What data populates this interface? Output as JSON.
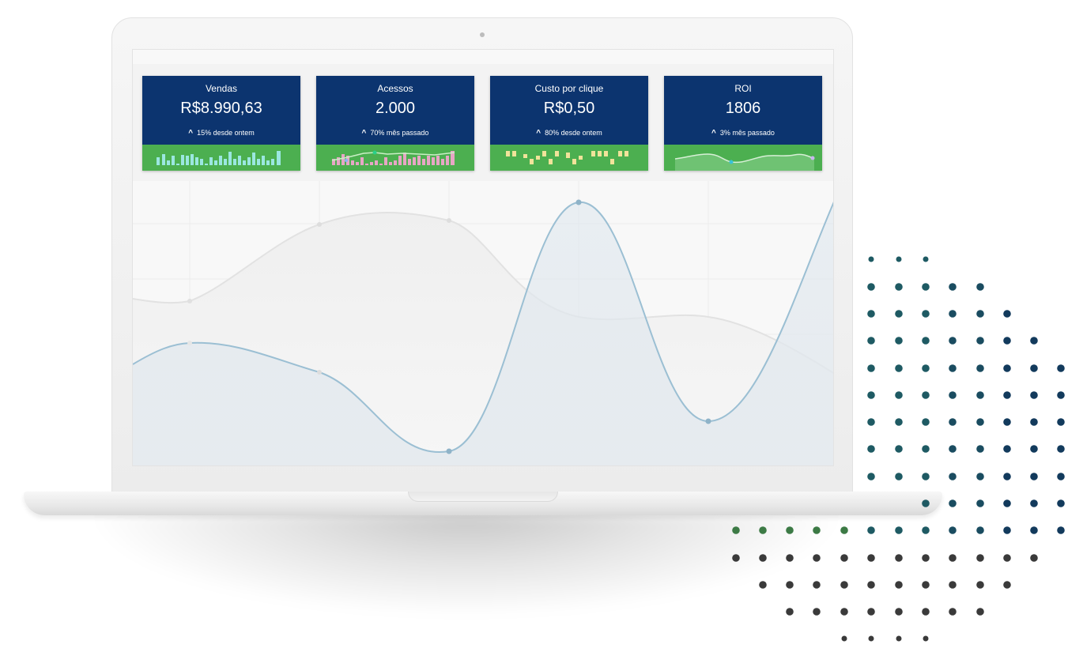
{
  "dashboard": {
    "cards": [
      {
        "title": "Vendas",
        "value": "R$8.990,63",
        "delta": "15% desde ontem",
        "spark": "bars"
      },
      {
        "title": "Acessos",
        "value": "2.000",
        "delta": "70% mês passado",
        "spark": "bars-line"
      },
      {
        "title": "Custo por clique",
        "value": "R$0,50",
        "delta": "80% desde ontem",
        "spark": "blocks"
      },
      {
        "title": "ROI",
        "value": "1806",
        "delta": "3% mês passado",
        "spark": "area"
      }
    ]
  },
  "colors": {
    "card_bg": "#0c346f",
    "spark_bg": "#4caf50",
    "bars": "#9be7e0",
    "pink_bars": "#e7a6c5",
    "blocks": "#f1e39a",
    "curve_blue": "#9bbfd3",
    "dot_green": "#3c7a45",
    "dot_teal": "#1e5a63",
    "dot_navy": "#123a5c",
    "dot_dark": "#3a3a3a"
  }
}
